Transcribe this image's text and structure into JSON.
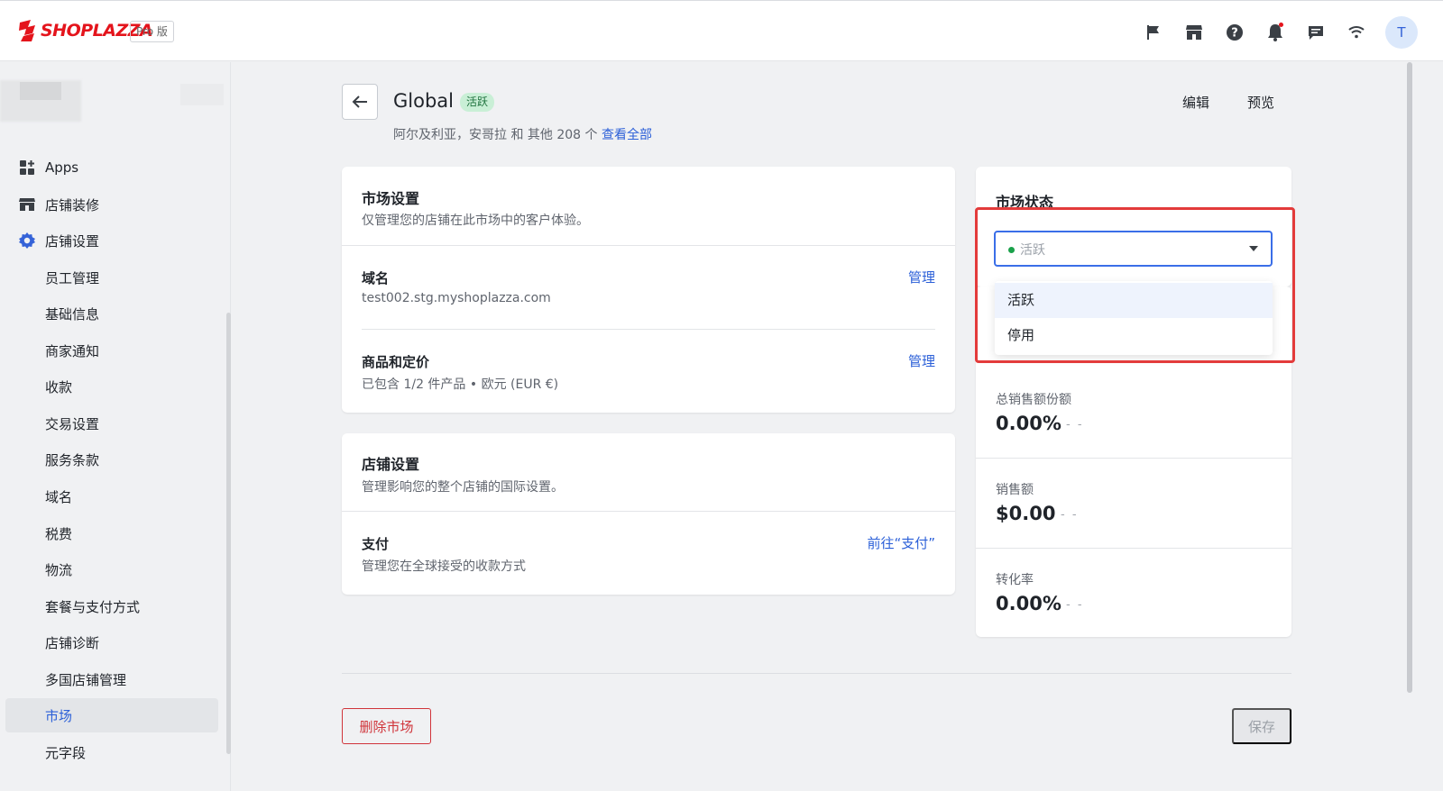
{
  "brand": {
    "logo_text": "SHOPLAZZA",
    "plan_badge": "Pro 版",
    "accent": "#e4141c"
  },
  "topbar": {
    "icons": [
      "flag-icon",
      "store-icon",
      "help-icon",
      "bell-icon",
      "message-icon",
      "wifi-icon"
    ],
    "avatar_initial": "T"
  },
  "sidebar": {
    "items": [
      {
        "label": "Apps",
        "icon": "apps-icon"
      },
      {
        "label": "店铺装修",
        "icon": "store-icon"
      },
      {
        "label": "店铺设置",
        "icon": "gear-icon"
      }
    ],
    "sub_items": [
      "员工管理",
      "基础信息",
      "商家通知",
      "收款",
      "交易设置",
      "服务条款",
      "域名",
      "税费",
      "物流",
      "套餐与支付方式",
      "店铺诊断",
      "多国店铺管理",
      "市场",
      "元字段"
    ],
    "active_item": "市场"
  },
  "header": {
    "title": "Global",
    "status_badge": "活跃",
    "subtitle_text": "阿尔及利亚，安哥拉 和 其他 208 个",
    "subtitle_link": "查看全部",
    "edit_label": "编辑",
    "preview_label": "预览"
  },
  "market_settings": {
    "title": "市场设置",
    "desc": "仅管理您的店铺在此市场中的客户体验。",
    "domain_title": "域名",
    "domain_value": "test002.stg.myshoplazza.com",
    "domain_link": "管理",
    "pricing_title": "商品和定价",
    "pricing_value": "已包含 1/2 件产品 • 欧元 (EUR €)",
    "pricing_link": "管理"
  },
  "store_settings": {
    "title": "店铺设置",
    "desc": "管理影响您的整个店铺的国际设置。",
    "payment_title": "支付",
    "payment_desc": "管理您在全球接受的收款方式",
    "payment_link": "前往“支付”"
  },
  "market_status": {
    "title": "市场状态",
    "selected": "活跃",
    "options": [
      "活跃",
      "停用"
    ]
  },
  "stats": [
    {
      "label": "总销售额份额",
      "value": "0.00%",
      "trend": "- -"
    },
    {
      "label": "销售额",
      "value": "$0.00",
      "trend": "- -"
    },
    {
      "label": "转化率",
      "value": "0.00%",
      "trend": "- -"
    }
  ],
  "footer": {
    "delete_label": "删除市场",
    "save_label": "保存"
  }
}
